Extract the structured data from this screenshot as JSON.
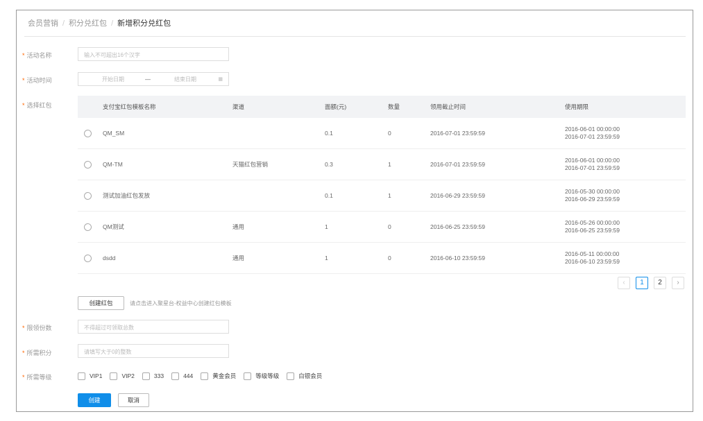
{
  "breadcrumb": [
    "会员营销",
    "积分兑红包",
    "新增积分兑红包"
  ],
  "labels": {
    "name": "活动名称",
    "time": "活动时间",
    "redpack": "选择红包",
    "limit": "限领份数",
    "points": "所需积分",
    "level": "所需等级"
  },
  "inputs": {
    "name_placeholder": "输入不可超出16个汉字",
    "start_placeholder": "开始日期",
    "range_sep": "—",
    "end_placeholder": "结束日期",
    "limit_placeholder": "不得超过可领取总数",
    "points_placeholder": "请填写大于0的整数"
  },
  "table": {
    "headers": [
      "支付宝红包模板名称",
      "渠道",
      "面额(元)",
      "数量",
      "领用截止时间",
      "使用期限"
    ],
    "rows": [
      [
        "QM_SM",
        "",
        "0.1",
        "0",
        "2016-07-01 23:59:59",
        "2016-06-01 00:00:00",
        "2016-07-01 23:59:59"
      ],
      [
        "QM-TM",
        "天猫红包营销",
        "0.3",
        "1",
        "2016-07-01 23:59:59",
        "2016-06-01 00:00:00",
        "2016-07-01 23:59:59"
      ],
      [
        "测试加油红包发放",
        "",
        "0.1",
        "1",
        "2016-06-29 23:59:59",
        "2016-05-30 00:00:00",
        "2016-06-29 23:59:59"
      ],
      [
        "QM测试",
        "通用",
        "1",
        "0",
        "2016-06-25 23:59:59",
        "2016-05-26 00:00:00",
        "2016-06-25 23:59:59"
      ],
      [
        "dsdd",
        "通用",
        "1",
        "0",
        "2016-06-10 23:59:59",
        "2016-05-11 00:00:00",
        "2016-06-10 23:59:59"
      ]
    ]
  },
  "pagination": {
    "prev": "‹",
    "pages": [
      "1",
      "2"
    ],
    "next": "›",
    "current": "1"
  },
  "create_redpack": {
    "label": "创建红包",
    "hint": "请点击进入聚星台-权益中心创建红包模板"
  },
  "levels": [
    "VIP1",
    "VIP2",
    "333",
    "444",
    "黄金会员",
    "等级等级",
    "白银会员"
  ],
  "actions": {
    "create": "创建",
    "cancel": "取消"
  },
  "colors": {
    "primary": "#108ee9",
    "required": "#ff6600"
  }
}
